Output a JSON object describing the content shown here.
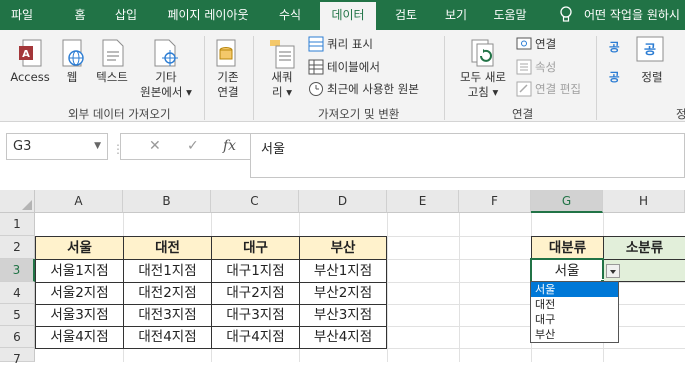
{
  "tabs": [
    "파일",
    "홈",
    "삽입",
    "페이지 레이아웃",
    "수식",
    "데이터",
    "검토",
    "보기",
    "도움말"
  ],
  "active_tab": "데이터",
  "tell_me": "어떤 작업을 원하시",
  "ribbon": {
    "ext": {
      "access": "Access",
      "web": "웹",
      "text": "텍스트",
      "other_line1": "기타",
      "other_line2": "원본에서 ▾",
      "existing_line1": "기존",
      "existing_line2": "연결",
      "group": "외부 데이터 가져오기"
    },
    "get": {
      "new_query_line1": "새쿼",
      "new_query_line2": "리 ▾",
      "show_queries": "쿼리 표시",
      "from_table": "테이블에서",
      "recent_sources": "최근에 사용한 원본",
      "group": "가져오기 및 변환"
    },
    "conn": {
      "refresh_line1": "모두 새로",
      "refresh_line2": "고침 ▾",
      "connections": "연결",
      "properties": "속성",
      "edit_links": "연결 편집",
      "group": "연결"
    },
    "sort": {
      "sort_label": "정렬",
      "az": "공",
      "za": "공",
      "group_abbrev": "정"
    }
  },
  "name_box": "G3",
  "fx": "fx",
  "formula": "서울",
  "columns": [
    "A",
    "B",
    "C",
    "D",
    "E",
    "F",
    "G",
    "H"
  ],
  "rows": [
    "1",
    "2",
    "3",
    "4",
    "5",
    "6",
    "7"
  ],
  "table": {
    "headers": [
      "서울",
      "대전",
      "대구",
      "부산"
    ],
    "rows": [
      [
        "서울1지점",
        "대전1지점",
        "대구1지점",
        "부산1지점"
      ],
      [
        "서울2지점",
        "대전2지점",
        "대구2지점",
        "부산2지점"
      ],
      [
        "서울3지점",
        "대전3지점",
        "대구3지점",
        "부산3지점"
      ],
      [
        "서울4지점",
        "대전4지점",
        "대구4지점",
        "부산4지점"
      ]
    ]
  },
  "category": {
    "major_label": "대분류",
    "minor_label": "소분류",
    "major_value": "서울"
  },
  "dropdown_options": [
    "서울",
    "대전",
    "대구",
    "부산"
  ],
  "dropdown_highlighted": "서울",
  "colors": {
    "excel_green": "#217346",
    "header_fill": "#fff2cc",
    "green_fill": "#e2efda",
    "select_blue": "#0078d7"
  }
}
